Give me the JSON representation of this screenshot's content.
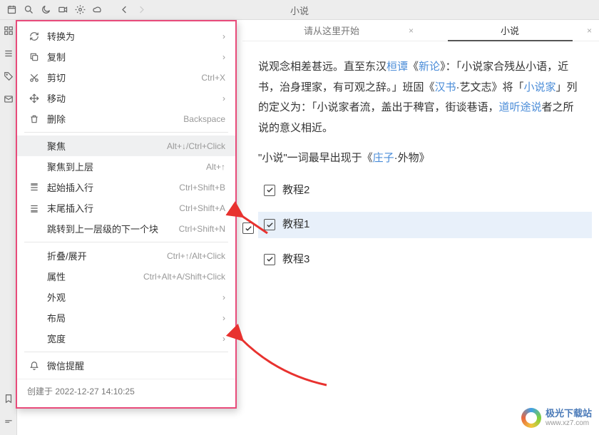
{
  "title_top": "小说",
  "tabs": [
    {
      "label": "请从这里开始"
    },
    {
      "label": "小说"
    }
  ],
  "content": {
    "line1_a": "说观念相差甚远。直至东汉",
    "link1": "桓谭",
    "line1_b": "《",
    "link2": "新论",
    "line1_c": "》：「小说家合残丛小语，近",
    "line2_a": "书，治身理家，有可观之辞。」班固《",
    "link3": "汉书",
    "line2_b": "·艺文志》将「",
    "link4": "小说家",
    "line2_c": "」列",
    "line3_a": "的定义为：「小说家者流，盖出于稗官，街谈巷语，",
    "link5": "道听途说",
    "line3_b": "者之所",
    "line4": "说的意义相近。",
    "line5_a": "\"小说\"一词最早出现于《",
    "link6": "庄子",
    "line5_b": "·外物》",
    "chk1": "教程2",
    "chk2": "教程1",
    "chk3": "教程3"
  },
  "menu": {
    "convert": "转换为",
    "copy": "复制",
    "cut": "剪切",
    "cut_k": "Ctrl+X",
    "move": "移动",
    "delete": "删除",
    "delete_k": "Backspace",
    "focus": "聚焦",
    "focus_k": "Alt+↓/Ctrl+Click",
    "focus_up": "聚焦到上层",
    "focus_up_k": "Alt+↑",
    "insert_start": "起始插入行",
    "insert_start_k": "Ctrl+Shift+B",
    "insert_end": "末尾插入行",
    "insert_end_k": "Ctrl+Shift+A",
    "jump_next": "跳转到上一层级的下一个块",
    "jump_next_k": "Ctrl+Shift+N",
    "fold": "折叠/展开",
    "fold_k": "Ctrl+↑/Alt+Click",
    "attr": "属性",
    "attr_k": "Ctrl+Alt+A/Shift+Click",
    "appearance": "外观",
    "layout": "布局",
    "width": "宽度",
    "wechat": "微信提醒",
    "created": "创建于 2022-12-27 14:10:25"
  },
  "watermark": {
    "t1": "极光下载站",
    "t2": "www.xz7.com"
  }
}
